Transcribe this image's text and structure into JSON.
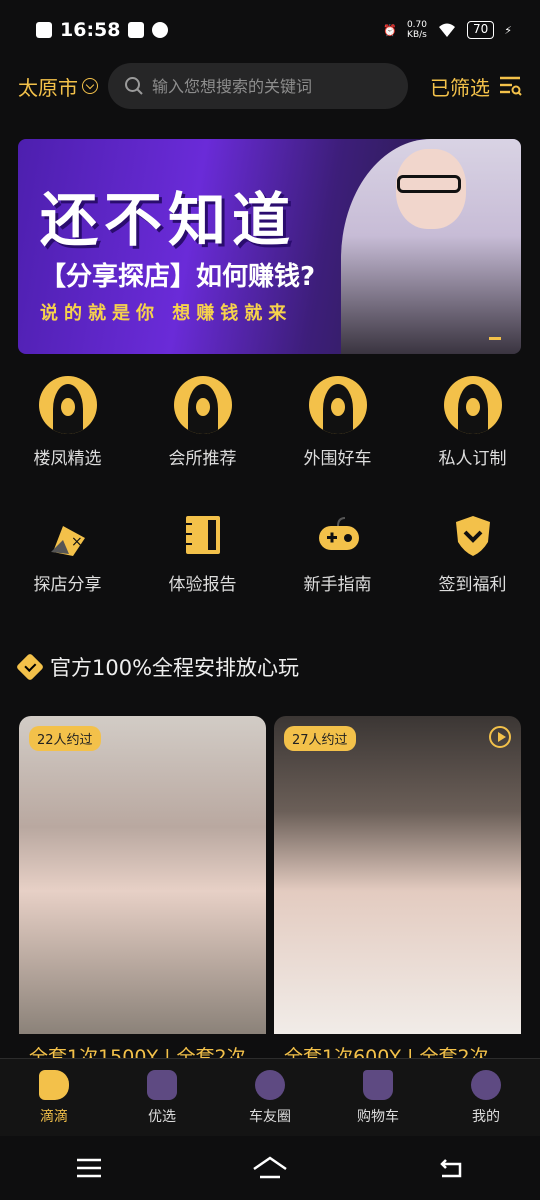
{
  "status": {
    "time": "16:58",
    "net": "0.70",
    "net_unit": "KB/s",
    "battery": "70"
  },
  "header": {
    "city": "太原市",
    "search_placeholder": "输入您想搜索的关键词",
    "filter": "已筛选"
  },
  "banner": {
    "line1": "还不知道",
    "line2": "【分享探店】如何赚钱?",
    "line3": "说的就是你 想赚钱就来"
  },
  "categories_row1": [
    "楼凤精选",
    "会所推荐",
    "外围好车",
    "私人订制"
  ],
  "categories_row2": [
    "探店分享",
    "体验报告",
    "新手指南",
    "签到福利"
  ],
  "section": {
    "title": "官方100%全程安排放心玩"
  },
  "cards": [
    {
      "badge": "22人约过",
      "caption": "全套1次1500Y | 全套2次"
    },
    {
      "badge": "27人约过",
      "caption": "全套1次600Y | 全套2次"
    }
  ],
  "tabs": [
    "滴滴",
    "优选",
    "车友圈",
    "购物车",
    "我的"
  ],
  "colors": {
    "accent": "#f3c14a",
    "background": "#0e0e0f"
  }
}
